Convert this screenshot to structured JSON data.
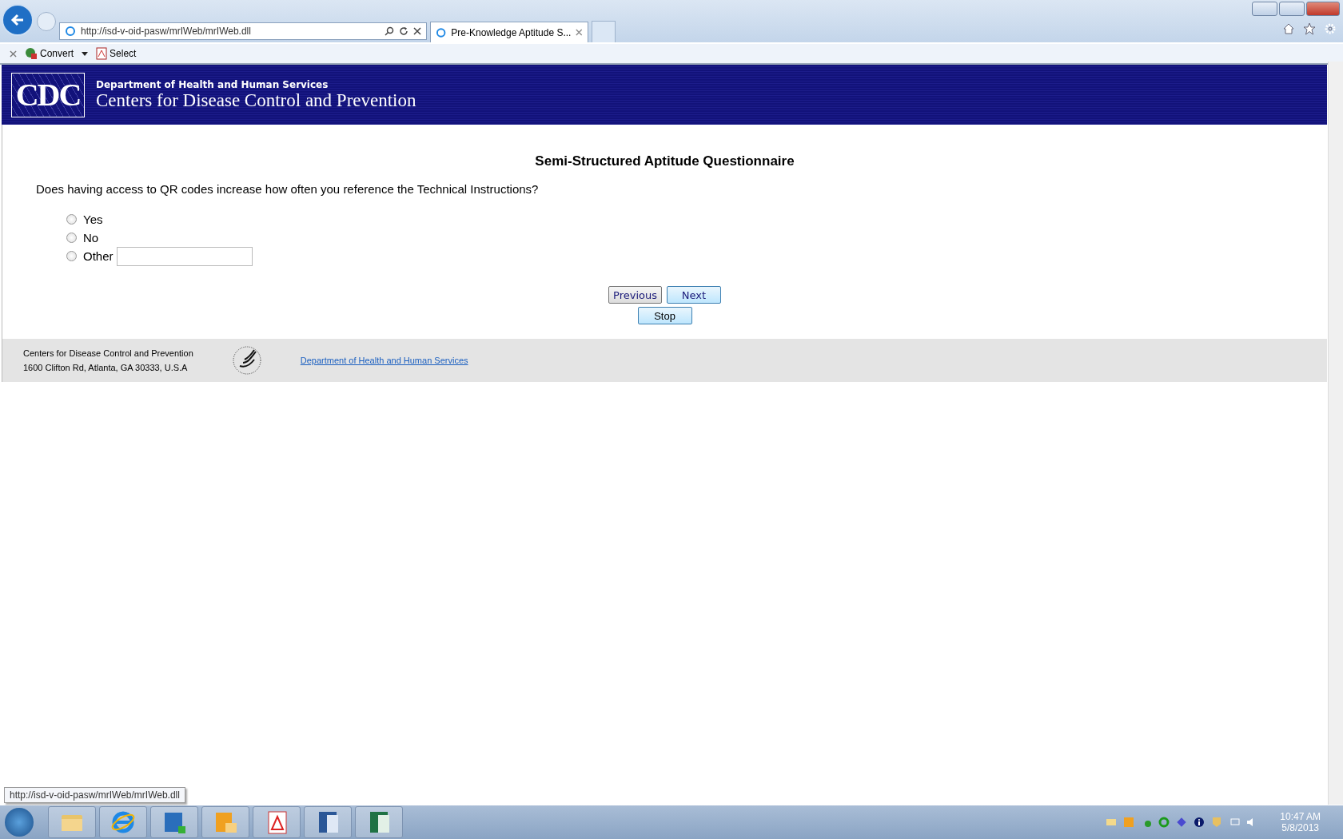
{
  "browser": {
    "address": "http://isd-v-oid-pasw/mrIWeb/mrIWeb.dll",
    "tab_title": "Pre-Knowledge Aptitude S...",
    "toolbar": [
      {
        "label": "Convert",
        "kind": "convert"
      },
      {
        "label": "Select",
        "kind": "select"
      }
    ]
  },
  "header": {
    "logo_text": "CDC",
    "department": "Department of Health and Human Services",
    "agency": "Centers for Disease Control and Prevention"
  },
  "survey": {
    "title": "Semi-Structured Aptitude Questionnaire",
    "question": "Does having access to QR codes increase how often you reference the Technical Instructions?",
    "options": [
      {
        "label": "Yes",
        "selected": false
      },
      {
        "label": "No",
        "selected": false
      },
      {
        "label": "Other",
        "selected": false,
        "kind": "other"
      }
    ],
    "buttons": [
      "Previous",
      "Next"
    ],
    "stop_button": "Stop"
  },
  "footer": {
    "lines": [
      "Centers for Disease Control and Prevention",
      "1600 Clifton Rd, Atlanta, GA 30333, U.S.A"
    ],
    "link": "Department of Health and Human Services"
  },
  "status_url": "http://isd-v-oid-pasw/mrIWeb/mrIWeb.dll",
  "taskbar": {
    "apps": [
      {
        "kind": "folder"
      },
      {
        "kind": "ie"
      },
      {
        "kind": "lync"
      },
      {
        "kind": "outlook"
      },
      {
        "kind": "pdf"
      },
      {
        "kind": "word"
      },
      {
        "kind": "excel"
      }
    ],
    "time": "10:47 AM",
    "date": "5/8/2013"
  }
}
